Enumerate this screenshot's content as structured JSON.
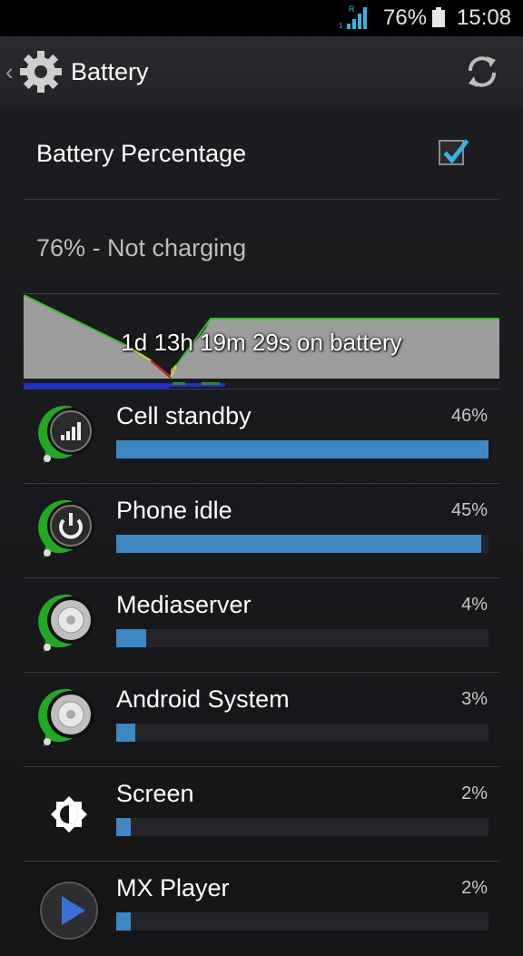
{
  "status_bar": {
    "battery_percent": "76%",
    "time": "15:08",
    "network_badge": "R"
  },
  "action_bar": {
    "title": "Battery"
  },
  "battery_percentage_pref": {
    "label": "Battery Percentage",
    "checked": true
  },
  "status": {
    "text": "76% - Not charging"
  },
  "history_graph": {
    "label": "1d 13h 19m 29s on battery"
  },
  "usage": [
    {
      "name": "Cell standby",
      "percent": "46%",
      "fraction": 1.0,
      "icon": "cell-standby-icon"
    },
    {
      "name": "Phone idle",
      "percent": "45%",
      "fraction": 0.98,
      "icon": "power-icon"
    },
    {
      "name": "Mediaserver",
      "percent": "4%",
      "fraction": 0.08,
      "icon": "mediaserver-icon"
    },
    {
      "name": "Android System",
      "percent": "3%",
      "fraction": 0.05,
      "icon": "android-system-icon"
    },
    {
      "name": "Screen",
      "percent": "2%",
      "fraction": 0.04,
      "icon": "brightness-icon"
    },
    {
      "name": "MX Player",
      "percent": "2%",
      "fraction": 0.04,
      "icon": "mx-player-icon"
    }
  ],
  "colors": {
    "accent_bar": "#3d88c2",
    "graph_line": "#36c42b",
    "checkbox_check": "#33b5e5"
  }
}
